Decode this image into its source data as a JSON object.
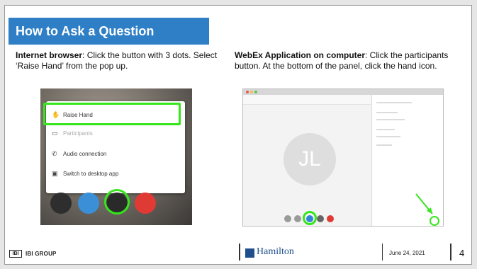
{
  "title": "How to Ask a Question",
  "left_instruction": {
    "bold": "Internet browser",
    "rest": ": Click the button with 3 dots. Select ‘Raise Hand’ from the pop up."
  },
  "right_instruction": {
    "bold": "WebEx Application on computer",
    "rest": ": Click the participants button. At the bottom of the panel, click the hand icon."
  },
  "browser_menu": {
    "items": [
      "Raise Hand",
      "Participants",
      "Audio connection",
      "Switch to desktop app"
    ]
  },
  "app_avatar_initials": "JL",
  "footer": {
    "logo_text": "IBI",
    "company": "IBI GROUP",
    "hamilton": "Hamilton",
    "date": "June 24, 2021",
    "page": "4"
  },
  "colors": {
    "title_bar": "#2f7fc6",
    "highlight": "#35e61b",
    "hamilton_blue": "#1f4f8c"
  }
}
